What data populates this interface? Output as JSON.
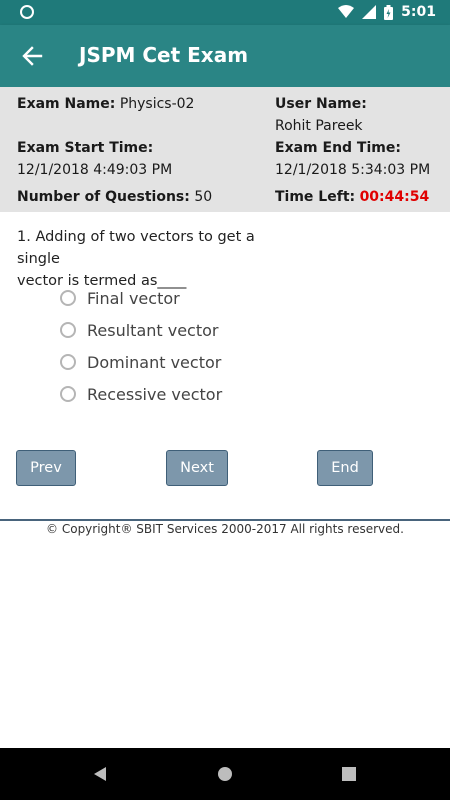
{
  "statusbar": {
    "time": "5:01"
  },
  "appbar": {
    "title": "JSPM Cet Exam"
  },
  "info": {
    "exam_name_label": "Exam Name:",
    "exam_name_value": "Physics-02",
    "user_name_label": "User Name:",
    "user_name_value": "Rohit Pareek",
    "start_time_label": "Exam Start Time:",
    "start_time_value": "12/1/2018 4:49:03 PM",
    "end_time_label": "Exam End Time:",
    "end_time_value": "12/1/2018 5:34:03 PM",
    "num_questions_label": "Number of Questions:",
    "num_questions_value": "50",
    "time_left_label": "Time Left:",
    "time_left_value": "00:44:54"
  },
  "question": {
    "text_line1": "1. Adding of two vectors to get a single",
    "text_line2": "vector is termed as____",
    "options": [
      "Final vector",
      "Resultant vector",
      "Dominant vector",
      "Recessive vector"
    ]
  },
  "buttons": {
    "prev": "Prev",
    "next": "Next",
    "end": "End"
  },
  "footer": {
    "copyright": "© Copyright® SBIT Services 2000-2017 All rights reserved."
  },
  "colors": {
    "appbar": "#2a8585",
    "statusbar": "#1f7a7a",
    "button": "#7d97ab",
    "time_left": "#e00000"
  }
}
